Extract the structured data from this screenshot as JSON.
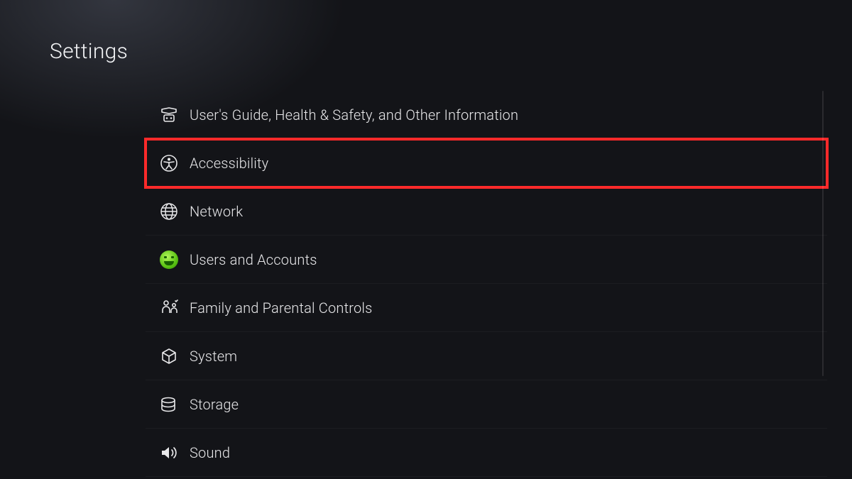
{
  "page": {
    "title": "Settings"
  },
  "settings": {
    "items": [
      {
        "id": "guide",
        "label": "User's Guide, Health & Safety, and Other Information",
        "icon": "guide-icon",
        "highlighted": false
      },
      {
        "id": "accessibility",
        "label": "Accessibility",
        "icon": "accessibility-icon",
        "highlighted": true
      },
      {
        "id": "network",
        "label": "Network",
        "icon": "network-icon",
        "highlighted": false
      },
      {
        "id": "users",
        "label": "Users and Accounts",
        "icon": "avatar-icon",
        "highlighted": false
      },
      {
        "id": "family",
        "label": "Family and Parental Controls",
        "icon": "family-icon",
        "highlighted": false
      },
      {
        "id": "system",
        "label": "System",
        "icon": "system-icon",
        "highlighted": false
      },
      {
        "id": "storage",
        "label": "Storage",
        "icon": "storage-icon",
        "highlighted": false
      },
      {
        "id": "sound",
        "label": "Sound",
        "icon": "sound-icon",
        "highlighted": false
      }
    ]
  },
  "annotation": {
    "highlight_color": "#ff2a2a"
  }
}
